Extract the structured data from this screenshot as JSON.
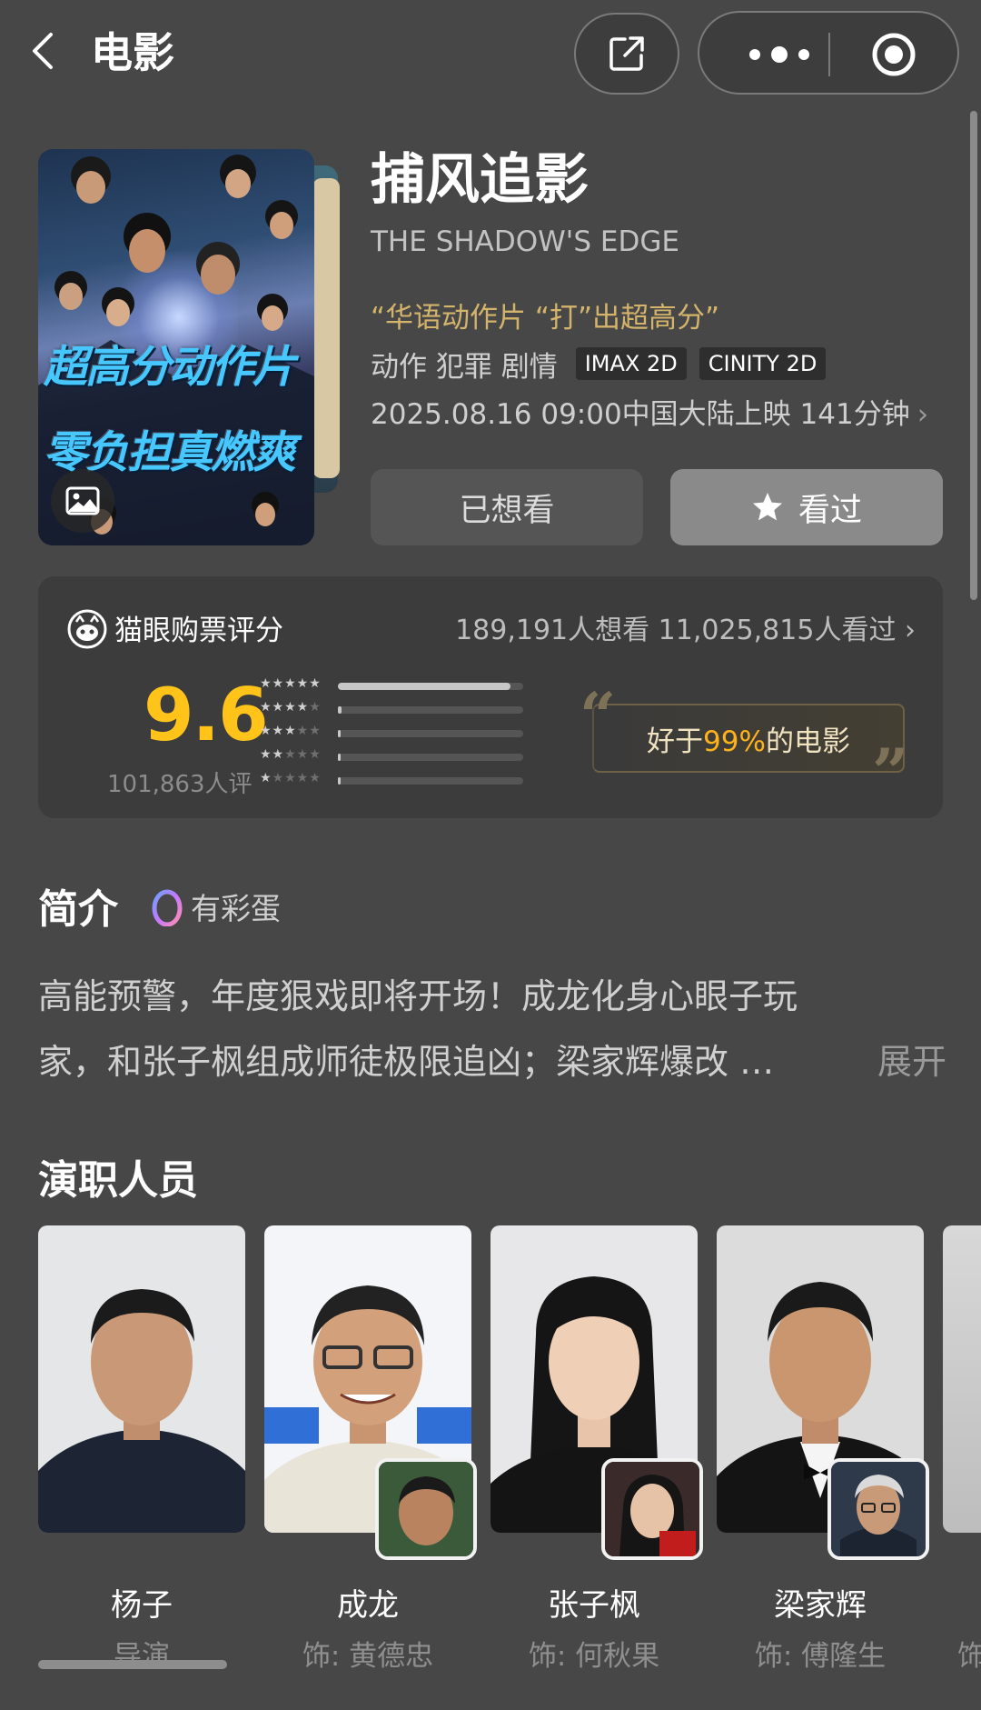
{
  "nav": {
    "title": "电影",
    "back_icon": "chevron-left-icon",
    "share_icon": "share-icon",
    "more_icon": "more-dots-icon",
    "target_icon": "target-icon"
  },
  "movie": {
    "poster_text_1": "超高分动作片",
    "poster_text_2": "零负担真燃爽",
    "poster_icon": "image-icon",
    "title_cn": "捕风追影",
    "title_en": "THE SHADOW'S EDGE",
    "slogan": "“华语动作片 “打”出超高分”",
    "genres": [
      "动作",
      "犯罪",
      "剧情"
    ],
    "formats": [
      "IMAX 2D",
      "CINITY 2D"
    ],
    "release": "2025.08.16 09:00中国大陆上映 141分钟",
    "wish_label": "已想看",
    "seen_label": "看过",
    "seen_icon": "star-icon"
  },
  "rating": {
    "source": "猫眼购票评分",
    "icon": "cat-eye-logo-icon",
    "stats": "189,191人想看 11,025,815人看过",
    "score": "9.6",
    "count": "101,863人评",
    "distribution": [
      0.93,
      0.02,
      0.01,
      0.01,
      0.01
    ],
    "better_prefix": "好于",
    "better_pct": "99%",
    "better_suffix": "的电影",
    "accent": "#ffc31a"
  },
  "intro": {
    "heading": "简介",
    "egg_label": "有彩蛋",
    "egg_icon": "egg-icon",
    "line1": "高能预警，年度狠戏即将开场！成龙化身心眼子玩",
    "line2": "家，和张子枫组成师徒极限追凶；梁家辉爆改 …",
    "expand": "展开"
  },
  "cast": {
    "heading": "演职人员",
    "members": [
      {
        "name": "杨子",
        "role": "导演"
      },
      {
        "name": "成龙",
        "role": "饰: 黄德忠"
      },
      {
        "name": "张子枫",
        "role": "饰: 何秋果"
      },
      {
        "name": "梁家辉",
        "role": "饰: 傅隆生"
      }
    ],
    "edge_role": "饰"
  }
}
